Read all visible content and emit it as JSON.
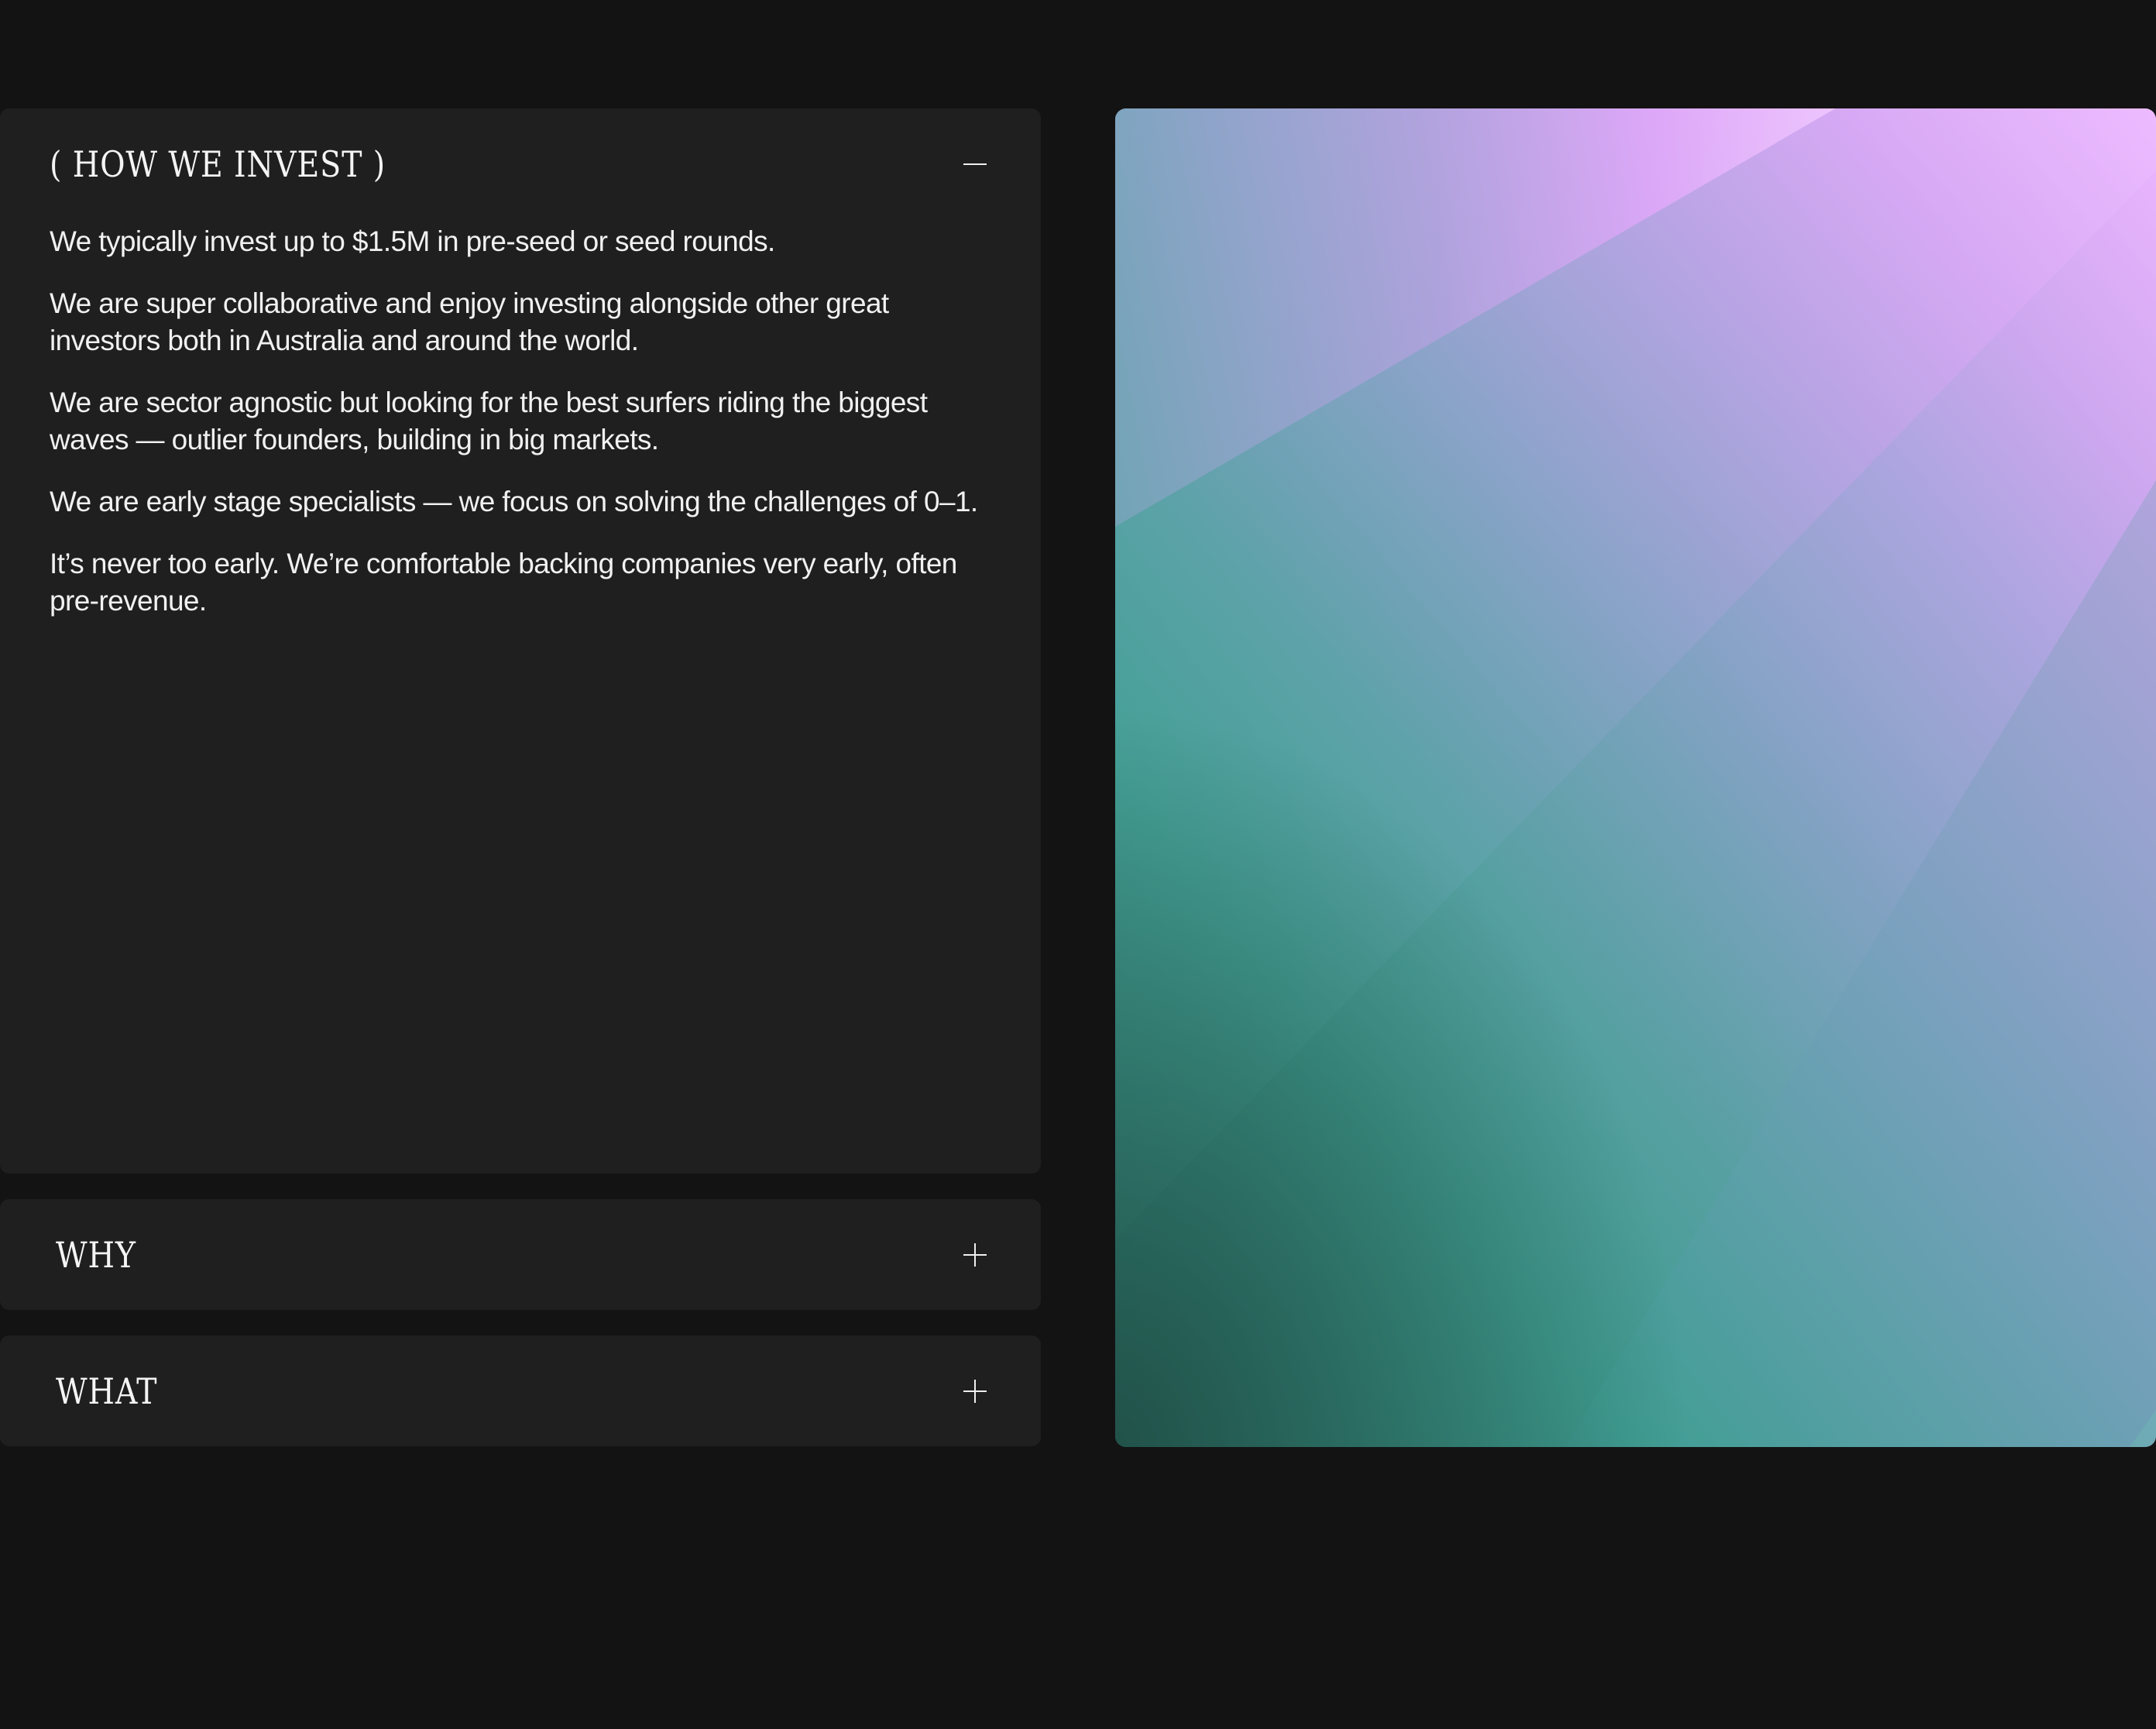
{
  "accordion": {
    "open_section": {
      "title": "( HOW WE INVEST )",
      "toggle_icon": "minus-icon",
      "paragraphs": [
        "We typically invest up to $1.5M in pre-seed or seed rounds.",
        "We are super collaborative and enjoy investing alongside other great investors both in Australia and around the world.",
        "We are sector agnostic but looking for the best surfers riding the biggest waves — outlier founders, building in big markets.",
        "We are early stage specialists  — we focus on solving the challenges of 0–1.",
        "It’s never too early. We’re comfortable backing companies very early, often pre-revenue."
      ]
    },
    "sections": [
      {
        "title": "WHY",
        "toggle_icon": "plus-icon"
      },
      {
        "title": "WHAT",
        "toggle_icon": "plus-icon"
      }
    ]
  },
  "hero": {
    "image": "abstract-gradient-image",
    "colors": {
      "violet": "#e9a6ff",
      "periwinkle": "#8ea3cc",
      "teal": "#399e8c",
      "deep_teal": "#2b6a5e"
    }
  }
}
